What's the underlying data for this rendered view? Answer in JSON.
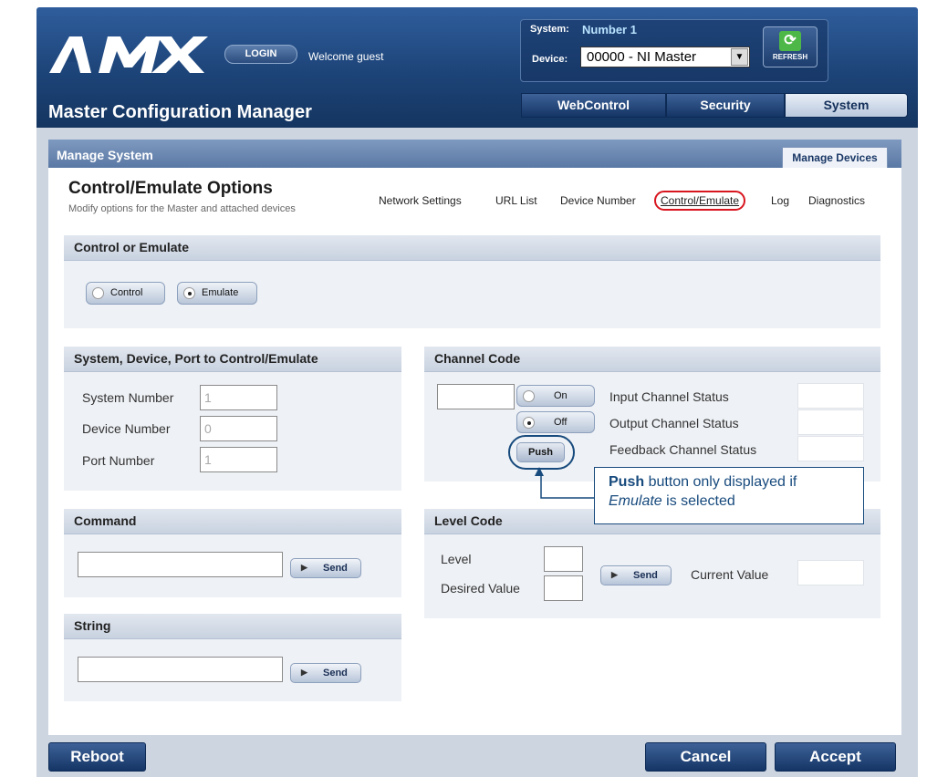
{
  "header": {
    "logo_text": "AMX",
    "login_label": "LOGIN",
    "welcome_text": "Welcome guest",
    "system_label": "System:",
    "system_value": "Number 1",
    "device_label": "Device:",
    "device_value": "00000 - NI Master",
    "refresh_label": "REFRESH",
    "app_title": "Master Configuration Manager",
    "tabs": [
      {
        "label": "WebControl"
      },
      {
        "label": "Security"
      },
      {
        "label": "System"
      }
    ]
  },
  "panel": {
    "title": "Manage System",
    "manage_devices_tab": "Manage Devices"
  },
  "page": {
    "title": "Control/Emulate Options",
    "subtitle": "Modify options for the Master and attached devices",
    "links": [
      {
        "label": "Network Settings"
      },
      {
        "label": "URL List"
      },
      {
        "label": "Device Number"
      },
      {
        "label": "Control/Emulate"
      },
      {
        "label": "Log"
      },
      {
        "label": "Diagnostics"
      }
    ]
  },
  "control_emulate": {
    "heading": "Control or Emulate",
    "options": [
      {
        "label": "Control",
        "selected": false
      },
      {
        "label": "Emulate",
        "selected": true
      }
    ]
  },
  "target": {
    "heading": "System, Device, Port to Control/Emulate",
    "fields": [
      {
        "label": "System Number",
        "value": "1"
      },
      {
        "label": "Device Number",
        "value": "0"
      },
      {
        "label": "Port Number",
        "value": "1"
      }
    ]
  },
  "channel": {
    "heading": "Channel Code",
    "on_label": "On",
    "off_label": "Off",
    "push_label": "Push",
    "statuses": [
      {
        "label": "Input Channel Status"
      },
      {
        "label": "Output Channel Status"
      },
      {
        "label": "Feedback Channel Status"
      }
    ]
  },
  "callout": {
    "bold": "Push",
    "text1": " button only displayed if",
    "italic": "Emulate",
    "text2": " is selected"
  },
  "command": {
    "heading": "Command",
    "send_label": "Send"
  },
  "level": {
    "heading": "Level Code",
    "level_label": "Level",
    "desired_label": "Desired Value",
    "send_label": "Send",
    "current_label": "Current Value"
  },
  "string": {
    "heading": "String",
    "send_label": "Send"
  },
  "footer": {
    "reboot_label": "Reboot",
    "cancel_label": "Cancel",
    "accept_label": "Accept"
  },
  "colors": {
    "header_blue": "#1d4478",
    "highlight_red": "#d8161f",
    "callout_blue": "#174a7d"
  }
}
